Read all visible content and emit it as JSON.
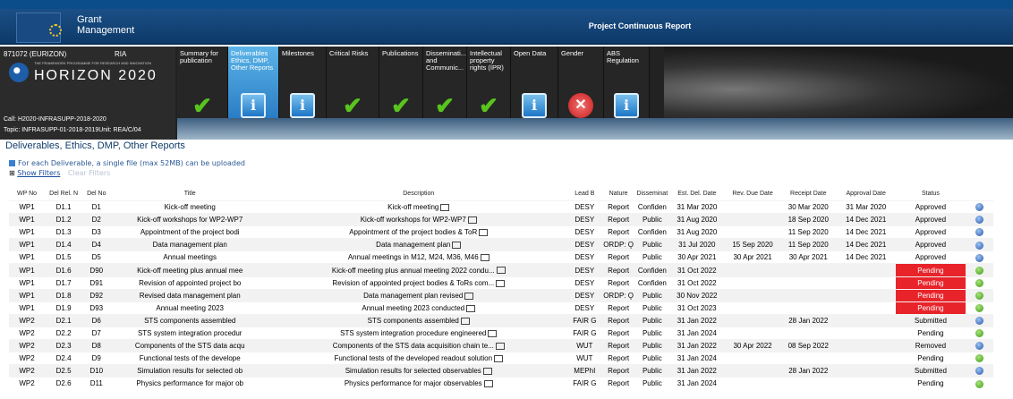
{
  "banner": {
    "app_title_line1": "Grant",
    "app_title_line2": "Management",
    "report_title": "Project Continuous Report"
  },
  "project": {
    "id": "871072 (EURIZON)",
    "type": "RIA",
    "programme_logo_text": "HORIZON 2020",
    "programme_tagline": "THE FRAMEWORK PROGRAMME FOR RESEARCH AND INNOVATION",
    "call": "Call: H2020-INFRASUPP-2018-2020",
    "topic": "Topic: INFRASUPP-01-2018-2019Unit: REA/C/04"
  },
  "tabs": [
    {
      "label": "Summary for publication",
      "icon": "check-icon",
      "active": false
    },
    {
      "label": "Deliverables Ethics, DMP, Other Reports",
      "icon": "info-icon",
      "active": true
    },
    {
      "label": "Milestones",
      "icon": "info-icon",
      "active": false
    },
    {
      "label": "Critical Risks",
      "icon": "check-icon",
      "active": false
    },
    {
      "label": "Publications",
      "icon": "check-icon",
      "active": false
    },
    {
      "label": "Disseminati... and Communic...",
      "icon": "check-icon",
      "active": false
    },
    {
      "label": "Intellectual property rights (IPR)",
      "icon": "check-icon",
      "active": false
    },
    {
      "label": "Open Data",
      "icon": "info-icon",
      "active": false
    },
    {
      "label": "Gender",
      "icon": "error-icon",
      "active": false
    },
    {
      "label": "ABS Regulation",
      "icon": "info-icon",
      "active": false
    }
  ],
  "section_title": "Deliverables, Ethics, DMP, Other Reports",
  "upload_note": "For each Deliverable, a single file (max 52MB) can be uploaded",
  "filters": {
    "show": "Show Filters",
    "clear": "Clear Filters"
  },
  "columns": [
    "WP No",
    "Del Rel. N",
    "Del No",
    "Title",
    "Description",
    "Lead B",
    "Nature",
    "Disseminat",
    "Est. Del. Date",
    "Rev. Due Date",
    "Receipt Date",
    "Approval Date",
    "Status",
    ""
  ],
  "rows": [
    {
      "wp": "WP1",
      "rel": "D1.1",
      "no": "D1",
      "title": "Kick-off meeting",
      "desc": "Kick-off meeting",
      "lead": "DESY",
      "nature": "Report",
      "diss": "Confiden",
      "est": "31 Mar 2020",
      "rev": "",
      "receipt": "30 Mar 2020",
      "approval": "31 Mar 2020",
      "status": "Approved",
      "pending": false,
      "icon": "blue"
    },
    {
      "wp": "WP1",
      "rel": "D1.2",
      "no": "D2",
      "title": "Kick-off workshops for WP2-WP7",
      "desc": "Kick-off workshops for WP2-WP7",
      "lead": "DESY",
      "nature": "Report",
      "diss": "Public",
      "est": "31 Aug 2020",
      "rev": "",
      "receipt": "18 Sep 2020",
      "approval": "14 Dec 2021",
      "status": "Approved",
      "pending": false,
      "icon": "blue"
    },
    {
      "wp": "WP1",
      "rel": "D1.3",
      "no": "D3",
      "title": "Appointment of the project bodi",
      "desc": "Appointment of the project bodies & ToR",
      "lead": "DESY",
      "nature": "Report",
      "diss": "Confiden",
      "est": "31 Aug 2020",
      "rev": "",
      "receipt": "11 Sep 2020",
      "approval": "14 Dec 2021",
      "status": "Approved",
      "pending": false,
      "icon": "blue"
    },
    {
      "wp": "WP1",
      "rel": "D1.4",
      "no": "D4",
      "title": "Data management plan",
      "desc": "Data management plan",
      "lead": "DESY",
      "nature": "ORDP: O̧",
      "diss": "Public",
      "est": "31 Jul 2020",
      "rev": "15 Sep 2020",
      "receipt": "11 Sep 2020",
      "approval": "14 Dec 2021",
      "status": "Approved",
      "pending": false,
      "icon": "blue"
    },
    {
      "wp": "WP1",
      "rel": "D1.5",
      "no": "D5",
      "title": "Annual meetings",
      "desc": "Annual meetings in M12, M24, M36, M46",
      "lead": "DESY",
      "nature": "Report",
      "diss": "Public",
      "est": "30 Apr 2021",
      "rev": "30 Apr 2021",
      "receipt": "30 Apr 2021",
      "approval": "14 Dec 2021",
      "status": "Approved",
      "pending": false,
      "icon": "blue"
    },
    {
      "wp": "WP1",
      "rel": "D1.6",
      "no": "D90",
      "title": "Kick-off meeting plus annual mee",
      "desc": "Kick-off meeting plus annual meeting 2022 condu...",
      "lead": "DESY",
      "nature": "Report",
      "diss": "Confiden",
      "est": "31 Oct 2022",
      "rev": "",
      "receipt": "",
      "approval": "",
      "status": "Pending",
      "pending": true,
      "icon": "green"
    },
    {
      "wp": "WP1",
      "rel": "D1.7",
      "no": "D91",
      "title": "Revision of appointed project bo",
      "desc": "Revision of appointed project bodies & ToRs com...",
      "lead": "DESY",
      "nature": "Report",
      "diss": "Confiden",
      "est": "31 Oct 2022",
      "rev": "",
      "receipt": "",
      "approval": "",
      "status": "Pending",
      "pending": true,
      "icon": "green"
    },
    {
      "wp": "WP1",
      "rel": "D1.8",
      "no": "D92",
      "title": "Revised data management plan",
      "desc": "Data management plan revised",
      "lead": "DESY",
      "nature": "ORDP: O̧",
      "diss": "Public",
      "est": "30 Nov 2022",
      "rev": "",
      "receipt": "",
      "approval": "",
      "status": "Pending",
      "pending": true,
      "icon": "green"
    },
    {
      "wp": "WP1",
      "rel": "D1.9",
      "no": "D93",
      "title": "Annual meeting 2023",
      "desc": "Annual meeting 2023 conducted",
      "lead": "DESY",
      "nature": "Report",
      "diss": "Public",
      "est": "31 Oct 2023",
      "rev": "",
      "receipt": "",
      "approval": "",
      "status": "Pending",
      "pending": true,
      "icon": "green"
    },
    {
      "wp": "WP2",
      "rel": "D2.1",
      "no": "D6",
      "title": "STS components assembled",
      "desc": "STS components assembled",
      "lead": "FAIR G",
      "nature": "Report",
      "diss": "Public",
      "est": "31 Jan 2022",
      "rev": "",
      "receipt": "28 Jan 2022",
      "approval": "",
      "status": "Submitted",
      "pending": false,
      "icon": "blue"
    },
    {
      "wp": "WP2",
      "rel": "D2.2",
      "no": "D7",
      "title": "STS system integration procedur",
      "desc": "STS system integration procedure engineered",
      "lead": "FAIR G",
      "nature": "Report",
      "diss": "Public",
      "est": "31 Jan 2024",
      "rev": "",
      "receipt": "",
      "approval": "",
      "status": "Pending",
      "pending": false,
      "icon": "green"
    },
    {
      "wp": "WP2",
      "rel": "D2.3",
      "no": "D8",
      "title": "Components of the STS data acqu",
      "desc": "Components of the STS data acquisition chain te...",
      "lead": "WUT",
      "nature": "Report",
      "diss": "Public",
      "est": "31 Jan 2022",
      "rev": "30 Apr 2022",
      "receipt": "08 Sep 2022",
      "approval": "",
      "status": "Removed",
      "pending": false,
      "icon": "blue"
    },
    {
      "wp": "WP2",
      "rel": "D2.4",
      "no": "D9",
      "title": "Functional tests of the develope",
      "desc": "Functional tests of the developed readout solution",
      "lead": "WUT",
      "nature": "Report",
      "diss": "Public",
      "est": "31 Jan 2024",
      "rev": "",
      "receipt": "",
      "approval": "",
      "status": "Pending",
      "pending": false,
      "icon": "green"
    },
    {
      "wp": "WP2",
      "rel": "D2.5",
      "no": "D10",
      "title": "Simulation results for selected ob",
      "desc": "Simulation results for selected observables",
      "lead": "MEPhI",
      "nature": "Report",
      "diss": "Public",
      "est": "31 Jan 2022",
      "rev": "",
      "receipt": "28 Jan 2022",
      "approval": "",
      "status": "Submitted",
      "pending": false,
      "icon": "blue"
    },
    {
      "wp": "WP2",
      "rel": "D2.6",
      "no": "D11",
      "title": "Physics performance for major ob",
      "desc": "Physics performance for major observables",
      "lead": "FAIR G",
      "nature": "Report",
      "diss": "Public",
      "est": "31 Jan 2024",
      "rev": "",
      "receipt": "",
      "approval": "",
      "status": "Pending",
      "pending": false,
      "icon": "green"
    }
  ]
}
